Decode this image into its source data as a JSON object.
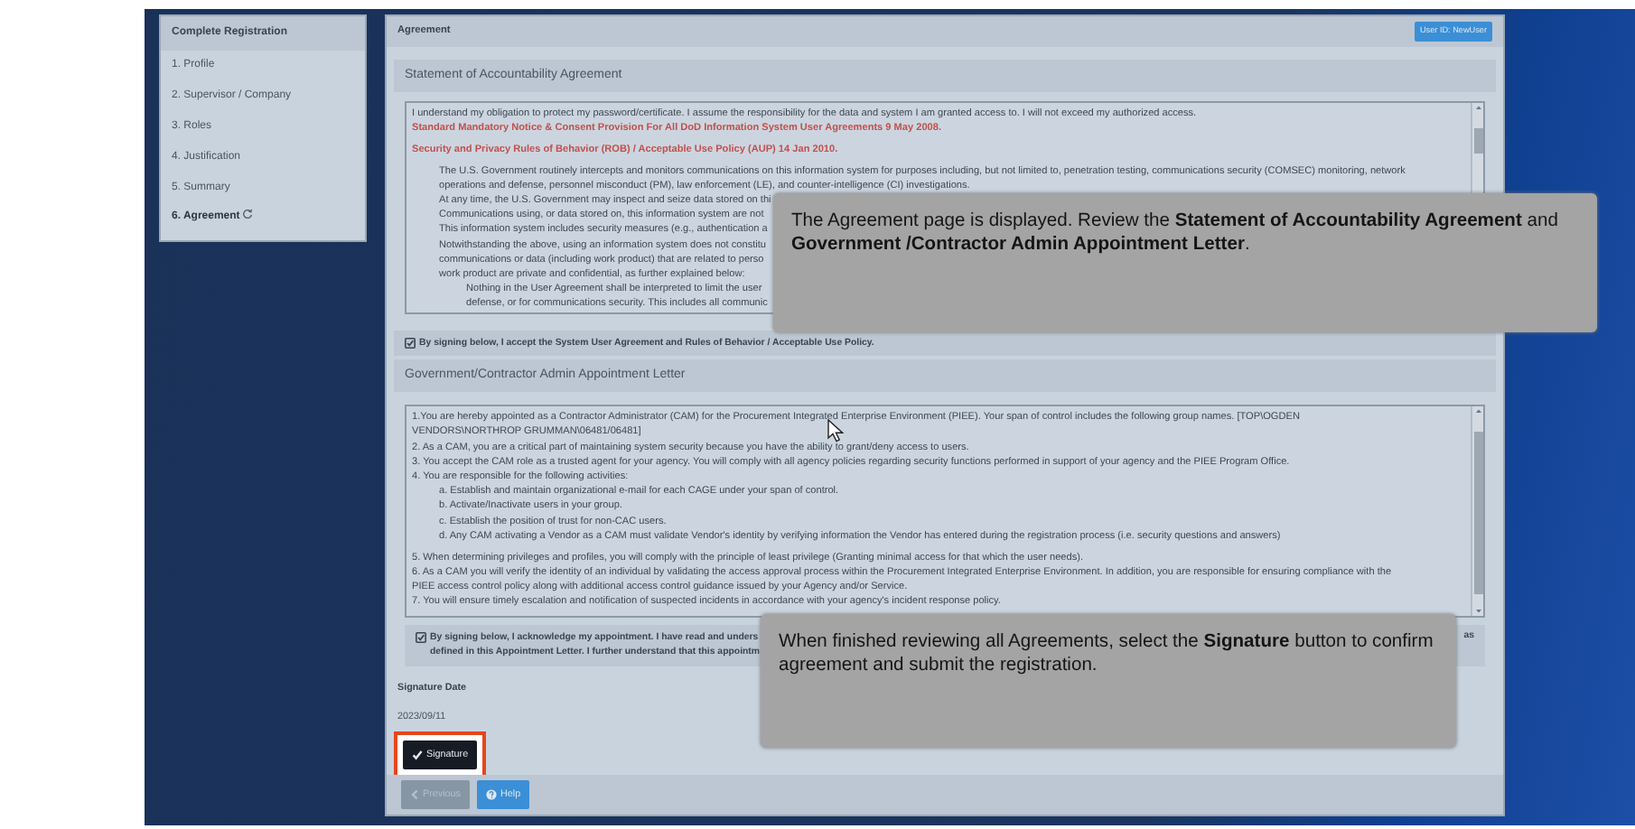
{
  "sidebar": {
    "title": "Complete Registration",
    "items": [
      {
        "label": "1. Profile",
        "selected": false
      },
      {
        "label": "2. Supervisor / Company",
        "selected": false
      },
      {
        "label": "3. Roles",
        "selected": false
      },
      {
        "label": "4. Justification",
        "selected": false
      },
      {
        "label": "5. Summary",
        "selected": false
      },
      {
        "label": "6. Agreement",
        "selected": true
      }
    ]
  },
  "main": {
    "title": "Agreement",
    "user_badge": "User ID: NewUser"
  },
  "sections": [
    {
      "heading": "Statement of Accountability Agreement",
      "lines": [
        {
          "kind": "plain",
          "text": "I understand my obligation to protect my password/certificate. I assume the responsibility for the data and system I am granted access to. I will not exceed my authorized access."
        },
        {
          "kind": "notice",
          "text": "Standard Mandatory Notice & Consent Provision For All DoD Information System User Agreements 9 May 2008."
        },
        {
          "kind": "notice",
          "space_before": true,
          "text": "Security and Privacy Rules of Behavior (ROB) / Acceptable Use Policy (AUP) 14 Jan 2010."
        },
        {
          "kind": "indent",
          "space_before": true,
          "text": "The U.S. Government routinely intercepts and monitors communications on this information system for purposes including, but not limited to, penetration testing, communications security (COMSEC) monitoring, network"
        },
        {
          "kind": "indent",
          "text": "operations and defense, personnel misconduct (PM), law enforcement (LE), and counter-intelligence (CI) investigations."
        },
        {
          "kind": "indent",
          "text": "At any time, the U.S. Government may inspect and seize data stored on thi"
        },
        {
          "kind": "indent",
          "text": "Communications using, or data stored on, this information system are not"
        },
        {
          "kind": "indent",
          "text": "This information system includes security measures (e.g., authentication a"
        },
        {
          "kind": "indent",
          "text": "Notwithstanding the above, using an information system does not constitu"
        },
        {
          "kind": "indent",
          "text": "communications or data (including work product) that are related to perso"
        },
        {
          "kind": "indent",
          "text": "work product are private and confidential, as further explained below:"
        },
        {
          "kind": "indent2",
          "text": "Nothing in the User Agreement shall be interpreted to limit the user"
        },
        {
          "kind": "indent2",
          "text": "defense, or for communications security. This includes all communic"
        }
      ],
      "acknowledgement": {
        "checked": true,
        "lines": [
          "By signing below, I accept the System User Agreement and Rules of Behavior / Acceptable Use Policy."
        ]
      }
    },
    {
      "heading": "Government/Contractor Admin Appointment Letter",
      "lines": [
        {
          "kind": "plain",
          "text": "1.You are hereby appointed as a Contractor Administrator (CAM) for the Procurement Integrated Enterprise Environment (PIEE). Your span of control includes the following group names. [TOP\\OGDEN"
        },
        {
          "kind": "plain",
          "text": "VENDORS\\NORTHROP GRUMMAN\\06481/06481]"
        },
        {
          "kind": "plain",
          "text": "2. As a CAM, you are a critical part of maintaining system security because you have the ability to grant/deny access to users."
        },
        {
          "kind": "plain",
          "text": "3. You accept the CAM role as a trusted agent for your agency. You will comply with all agency policies regarding security functions performed in support of your agency and the PIEE Program Office."
        },
        {
          "kind": "plain",
          "text": "4. You are responsible for the following activities:"
        },
        {
          "kind": "indent",
          "text": "a. Establish and maintain organizational e-mail for each CAGE under your span of control."
        },
        {
          "kind": "indent",
          "text": "b. Activate/Inactivate users in your group."
        },
        {
          "kind": "indent",
          "text": "c. Establish the position of trust for non-CAC users."
        },
        {
          "kind": "indent",
          "text": "d. Any CAM activating a Vendor as a CAM must validate Vendor's identity by verifying information the Vendor has entered during the registration process (i.e. security questions and answers)"
        },
        {
          "kind": "plain",
          "space_before": true,
          "text": "5. When determining privileges and profiles, you will comply with the principle of least privilege (Granting minimal access for that which the user needs)."
        },
        {
          "kind": "plain",
          "text": "6. As a CAM you will verify the identity of an individual by validating the access approval process within the Procurement Integrated Enterprise Environment. In addition, you are responsible for ensuring compliance with the"
        },
        {
          "kind": "plain",
          "text": "PIEE access control policy along with additional access control guidance issued by your Agency and/or Service."
        },
        {
          "kind": "plain",
          "text": "7. You will ensure timely escalation and notification of suspected incidents in accordance with your agency's incident response policy."
        }
      ],
      "acknowledgement": {
        "checked": true,
        "lines": [
          "By signing below, I acknowledge my appointment. I have read and unders",
          "defined in this Appointment Letter. I further understand that this appointm"
        ],
        "tail": "as"
      }
    }
  ],
  "signature_date": {
    "label": "Signature Date",
    "value": "2023/09/11"
  },
  "signature_button": "Signature",
  "footer_buttons": [
    {
      "kind": "previous",
      "label": "Previous",
      "disabled": true
    },
    {
      "kind": "help",
      "label": "Help",
      "disabled": false
    }
  ],
  "callouts": [
    {
      "text": "The Agreement page is displayed. Review the **Statement of Accountability Agreement** and **Government /Contractor Admin Appointment Letter**."
    },
    {
      "text": "When finished reviewing all Agreements, select the **Signature** button to confirm agreement and submit the registration."
    }
  ]
}
